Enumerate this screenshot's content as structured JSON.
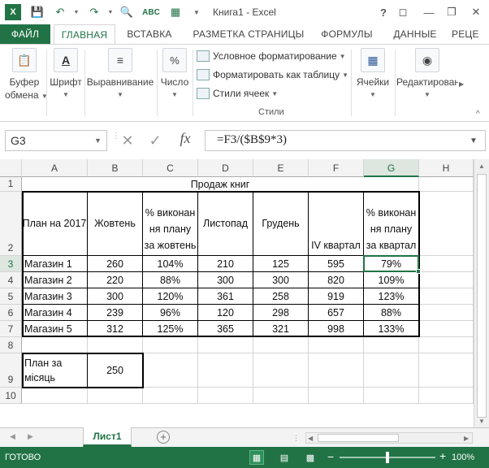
{
  "app": {
    "window_title": "Книга1 - Excel",
    "help": "?",
    "accent_color": "#217346"
  },
  "quick_access": {
    "icons": [
      "excel-logo-icon",
      "save-icon",
      "undo-icon",
      "redo-icon",
      "print-preview-icon",
      "spell-check-icon",
      "customize-icon"
    ]
  },
  "tabs": [
    "ФАЙЛ",
    "ГЛАВНАЯ",
    "ВСТАВКА",
    "РАЗМЕТКА СТРАНИЦЫ",
    "ФОРМУЛЫ",
    "ДАННЫЕ",
    "РЕЦЕ"
  ],
  "ribbon": {
    "clipboard": [
      "Буфер",
      "обмена"
    ],
    "font": "Шрифт",
    "alignment": "Выравнивание",
    "number": "Число",
    "number_icon": "%",
    "styles": {
      "conditional": "Условное форматирование",
      "as_table": "Форматировать как таблицу",
      "cell_styles": "Стили ячеек",
      "group_label": "Стили"
    },
    "cells": "Ячейки",
    "editing": "Редактирование"
  },
  "formula_bar": {
    "name_box": "G3",
    "fx": "fx",
    "formula": "=F3/($B$9*3)"
  },
  "grid": {
    "columns": [
      "A",
      "B",
      "C",
      "D",
      "E",
      "F",
      "G",
      "H"
    ],
    "rows": [
      "1",
      "2",
      "3",
      "4",
      "5",
      "6",
      "7",
      "8",
      "9",
      "10"
    ],
    "selected_column": "G",
    "selected_row": "3",
    "title": "Продаж книг",
    "headers": [
      "План на 2017",
      "Жовтень",
      "% виконан ня плану за жовтень",
      "Листопад",
      "Грудень",
      "IV квартал",
      "% виконан ня плану за квартал"
    ],
    "data": [
      [
        "Магазин 1",
        "260",
        "104%",
        "210",
        "125",
        "595",
        "79%"
      ],
      [
        "Магазин 2",
        "220",
        "88%",
        "300",
        "300",
        "820",
        "109%"
      ],
      [
        "Магазин 3",
        "300",
        "120%",
        "361",
        "258",
        "919",
        "123%"
      ],
      [
        "Магазин 4",
        "239",
        "96%",
        "120",
        "298",
        "657",
        "88%"
      ],
      [
        "Магазин 5",
        "312",
        "125%",
        "365",
        "321",
        "998",
        "133%"
      ]
    ],
    "plan_label": "План за місяць",
    "plan_value": "250"
  },
  "sheets": {
    "active": "Лист1",
    "add": "+"
  },
  "status": {
    "text": "ГОТОВО",
    "zoom": "100%",
    "zoom_minus": "−",
    "zoom_plus": "+"
  }
}
